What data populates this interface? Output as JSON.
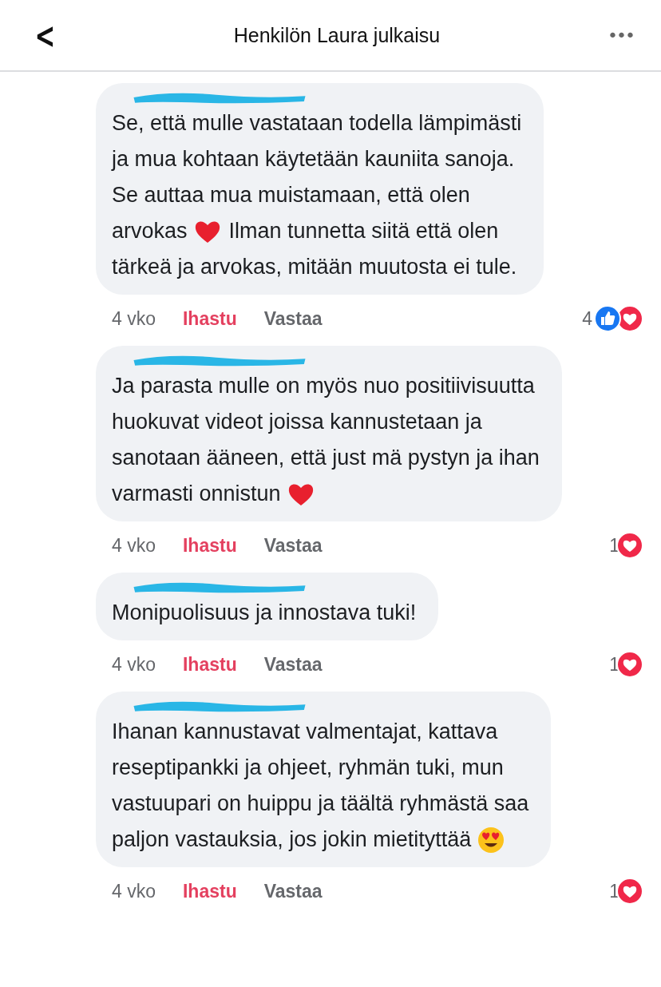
{
  "header": {
    "back": "<",
    "title": "Henkilön Laura julkaisu",
    "menu": "•••"
  },
  "comments": [
    {
      "lines": [
        [
          {
            "kind": "text",
            "text": "Se, että mulle vastataan todella lämpimästi"
          }
        ],
        [
          {
            "kind": "text",
            "text": "ja mua kohtaan käytetään kauniita sanoja."
          }
        ],
        [
          {
            "kind": "text",
            "text": "Se auttaa mua muistamaan, että olen"
          }
        ],
        [
          {
            "kind": "text",
            "text": "arvokas"
          },
          {
            "kind": "heart"
          },
          {
            "kind": "text",
            "text": "Ilman tunnetta siitä että olen"
          }
        ],
        [
          {
            "kind": "text",
            "text": "tärkeä ja arvokas, mitään muutosta ei tule."
          }
        ]
      ],
      "time": "4 vko",
      "like": {
        "label": "Ihastu",
        "selected": true
      },
      "reply": "Vastaa",
      "reaction_count": "4",
      "reactions": [
        {
          "kind": "like"
        },
        {
          "kind": "love"
        }
      ]
    },
    {
      "lines": [
        [
          {
            "kind": "text",
            "text": "Ja parasta mulle on myös nuo positiivisuutta"
          }
        ],
        [
          {
            "kind": "text",
            "text": "huokuvat videot joissa kannustetaan ja"
          }
        ],
        [
          {
            "kind": "text",
            "text": "sanotaan ääneen, että just mä pystyn ja ihan"
          }
        ],
        [
          {
            "kind": "text",
            "text": "varmasti onnistun"
          },
          {
            "kind": "heart"
          }
        ]
      ],
      "time": "4 vko",
      "like": {
        "label": "Ihastu",
        "selected": true
      },
      "reply": "Vastaa",
      "reaction_count": "1",
      "reactions": [
        {
          "kind": "love"
        }
      ]
    },
    {
      "lines": [
        [
          {
            "kind": "text",
            "text": "Monipuolisuus ja innostava tuki!"
          }
        ]
      ],
      "time": "4 vko",
      "like": {
        "label": "Ihastu",
        "selected": true
      },
      "reply": "Vastaa",
      "reaction_count": "1",
      "reactions": [
        {
          "kind": "love"
        }
      ]
    },
    {
      "lines": [
        [
          {
            "kind": "text",
            "text": "Ihanan kannustavat valmentajat, kattava"
          }
        ],
        [
          {
            "kind": "text",
            "text": "reseptipankki ja ohjeet, ryhmän tuki, mun"
          }
        ],
        [
          {
            "kind": "text",
            "text": "vastuupari on huippu ja täältä ryhmästä saa"
          }
        ],
        [
          {
            "kind": "text",
            "text": "paljon vastauksia, jos jokin mietityttää"
          },
          {
            "kind": "heart-eyes"
          }
        ]
      ],
      "time": "4 vko",
      "like": {
        "label": "Ihastu",
        "selected": true
      },
      "reply": "Vastaa",
      "reaction_count": "1",
      "reactions": [
        {
          "kind": "love"
        }
      ]
    }
  ]
}
